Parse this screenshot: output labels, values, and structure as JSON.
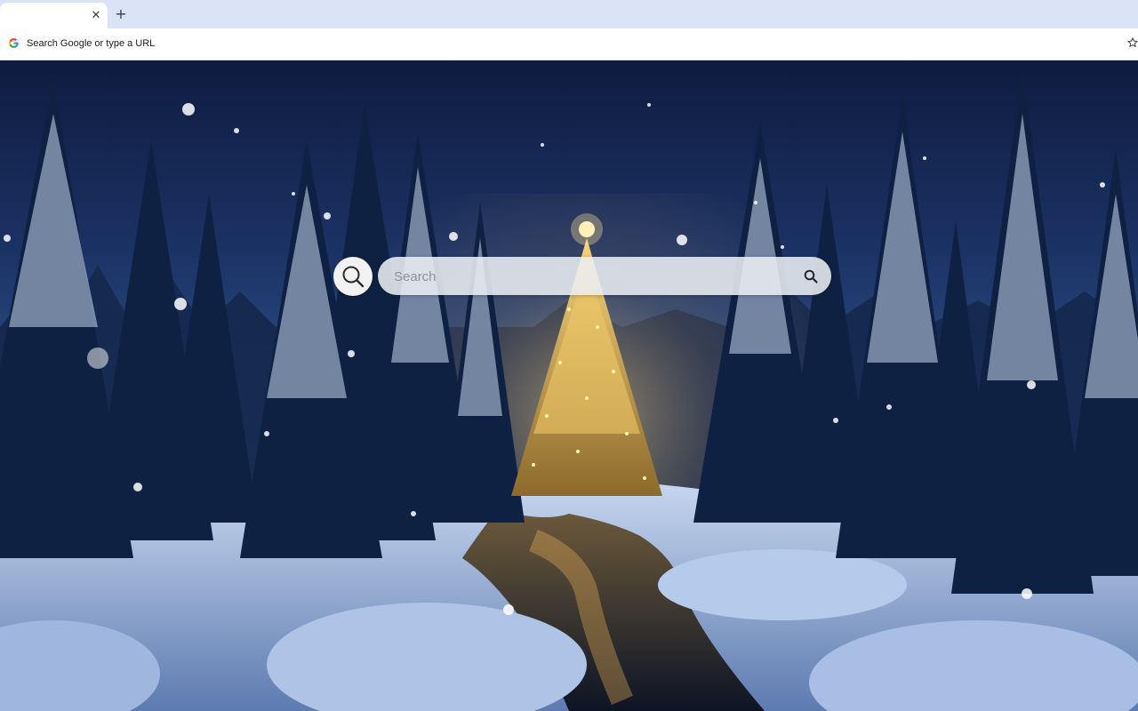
{
  "tabstrip": {
    "close_glyph": "✕",
    "new_tab_glyph": "+"
  },
  "omnibox": {
    "placeholder": "Search Google or type a URL"
  },
  "icons": {
    "omnibox_left": "google-g-icon",
    "bookmark": "star-icon",
    "search_round": "magnifier-icon",
    "search_submit": "search-icon"
  },
  "search": {
    "placeholder": "Search"
  },
  "colors": {
    "tabstrip_bg": "#dbe4f7",
    "sky_top": "#0e1b3f",
    "tree_lights": "#ffcf5c"
  }
}
